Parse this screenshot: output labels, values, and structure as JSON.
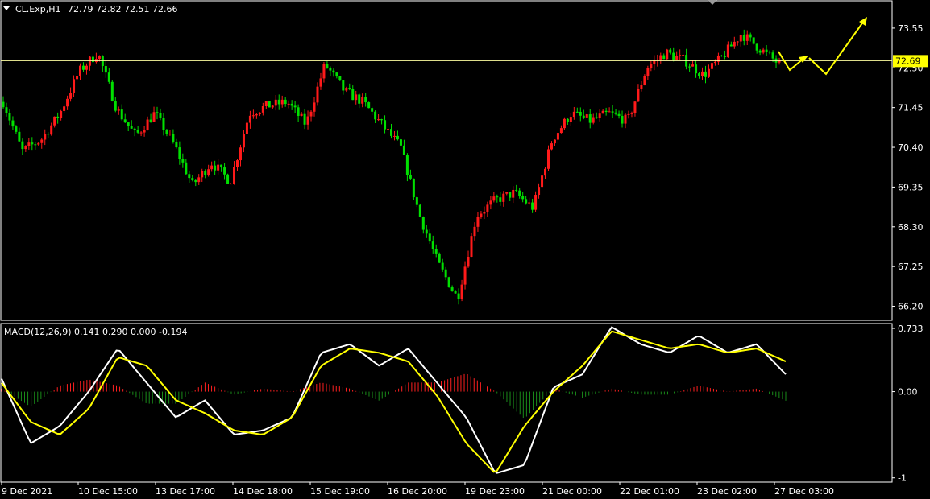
{
  "chart_data": [
    {
      "type": "candlestick",
      "title": "CL.Exp,H1",
      "ohlc_readout": "72.79 72.82 72.51 72.66",
      "y_ticks": [
        "73.55",
        "72.50",
        "71.45",
        "70.40",
        "69.35",
        "68.30",
        "67.25",
        "66.20"
      ],
      "y_tick_values": [
        73.55,
        72.5,
        71.45,
        70.4,
        69.35,
        68.3,
        67.25,
        66.2
      ],
      "ylim": [
        65.85,
        74.25
      ],
      "current_price": "72.69",
      "current_price_value": 72.69,
      "x_ticks": [
        "9 Dec 2021",
        "10 Dec 15:00",
        "13 Dec 17:00",
        "14 Dec 18:00",
        "15 Dec 19:00",
        "16 Dec 20:00",
        "19 Dec 23:00",
        "21 Dec 00:00",
        "22 Dec 01:00",
        "23 Dec 02:00",
        "27 Dec 03:00"
      ],
      "anchors": [
        71.6,
        70.3,
        70.6,
        71.3,
        72.4,
        72.9,
        71.4,
        70.7,
        71.3,
        70.5,
        69.4,
        70.0,
        69.5,
        71.3,
        71.5,
        71.6,
        71.0,
        72.6,
        71.9,
        71.6,
        71.0,
        70.4,
        68.6,
        67.3,
        66.4,
        68.6,
        69.0,
        69.2,
        68.8,
        70.6,
        71.3,
        71.1,
        71.3,
        71.1,
        72.5,
        72.9,
        72.7,
        72.3,
        72.8,
        73.4,
        73.0,
        72.6
      ],
      "colors": {
        "up": "#ff1a1a",
        "down": "#00e000",
        "macd_hist_up": "#ff2020",
        "macd_hist_down": "#1a8c1a",
        "macd_line": "#ffffff",
        "signal_line": "#ffff00",
        "price_line": "#ffffa0",
        "forecast_arrows": "#ffff00"
      }
    },
    {
      "type": "macd",
      "title": "MACD(12,26,9) 0.141 0.290 0.000 -0.194",
      "y_ticks": [
        "0.733",
        "0.00",
        "-1"
      ],
      "y_tick_values": [
        0.733,
        0.0,
        -1.0
      ],
      "ylim": [
        -1.04,
        0.78
      ],
      "macd_anchors": [
        0.15,
        -0.6,
        -0.4,
        0.0,
        0.5,
        0.1,
        -0.3,
        -0.1,
        -0.5,
        -0.45,
        -0.3,
        0.45,
        0.55,
        0.3,
        0.5,
        0.1,
        -0.3,
        -0.95,
        -0.85,
        0.05,
        0.2,
        0.75,
        0.55,
        0.45,
        0.65,
        0.45,
        0.55,
        0.2
      ],
      "signal_anchors": [
        0.1,
        -0.35,
        -0.5,
        -0.2,
        0.4,
        0.3,
        -0.1,
        -0.25,
        -0.45,
        -0.5,
        -0.3,
        0.3,
        0.5,
        0.45,
        0.35,
        -0.05,
        -0.6,
        -0.95,
        -0.4,
        0.0,
        0.3,
        0.7,
        0.6,
        0.5,
        0.55,
        0.45,
        0.5,
        0.35
      ]
    }
  ]
}
